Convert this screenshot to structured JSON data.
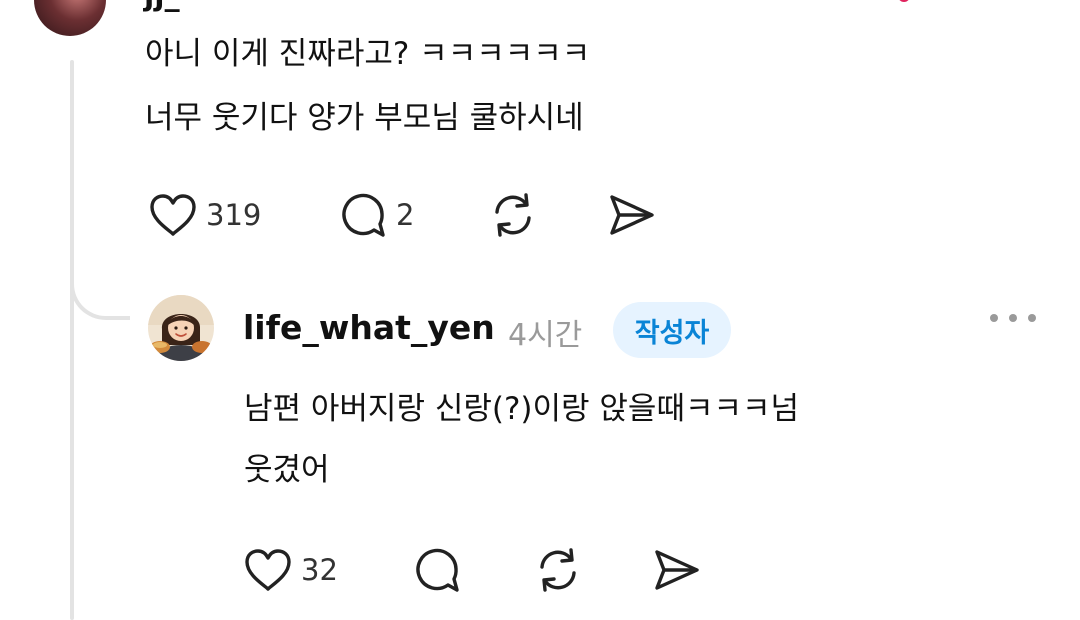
{
  "top_post": {
    "username_fragment": "jj_",
    "lines": [
      "아니 이게 진짜라고? ㅋㅋㅋㅋㅋㅋ",
      "너무 웃기다 양가 부모님 쿨하시네"
    ],
    "likes": "319",
    "comments": "2"
  },
  "reply": {
    "username": "life_what_yen",
    "time": "4시간",
    "badge": "작성자",
    "lines": [
      "남편 아버지랑 신랑(?)이랑 앉을때ㅋㅋㅋ넘",
      "웃겼어"
    ],
    "likes": "32"
  },
  "icons": {
    "like": "heart-icon",
    "comment": "comment-bubble-icon",
    "repost": "repost-icon",
    "share": "send-icon",
    "more": "more-dots-icon"
  },
  "colors": {
    "badge_bg": "#e6f3ff",
    "badge_text": "#0a84d6",
    "muted_text": "#9a9a9a",
    "thread_line": "#e3e3e3"
  }
}
